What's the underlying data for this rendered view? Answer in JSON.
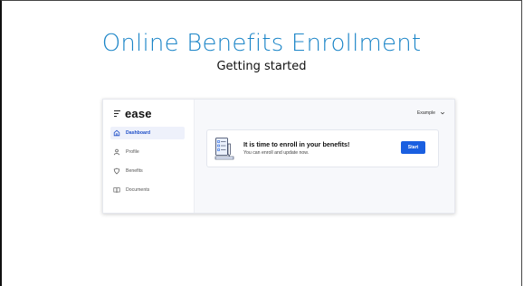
{
  "slide": {
    "title": "Online Benefits Enrollment",
    "subtitle": "Getting started"
  },
  "app": {
    "brand": "ease",
    "employer_select": "Example",
    "sidebar": {
      "items": [
        {
          "label": "Dashboard",
          "icon": "home-icon",
          "active": true
        },
        {
          "label": "Profile",
          "icon": "person-icon",
          "active": false
        },
        {
          "label": "Benefits",
          "icon": "shield-icon",
          "active": false
        },
        {
          "label": "Documents",
          "icon": "book-icon",
          "active": false
        }
      ]
    },
    "enroll_card": {
      "title": "It is time to enroll in your benefits!",
      "text": "You can enroll and update now.",
      "button": "Start",
      "illustration": "checklist-pencil-icon"
    }
  },
  "colors": {
    "title": "#1d86c8",
    "accent": "#1a5fe0",
    "active_bg": "#eef1fb"
  }
}
